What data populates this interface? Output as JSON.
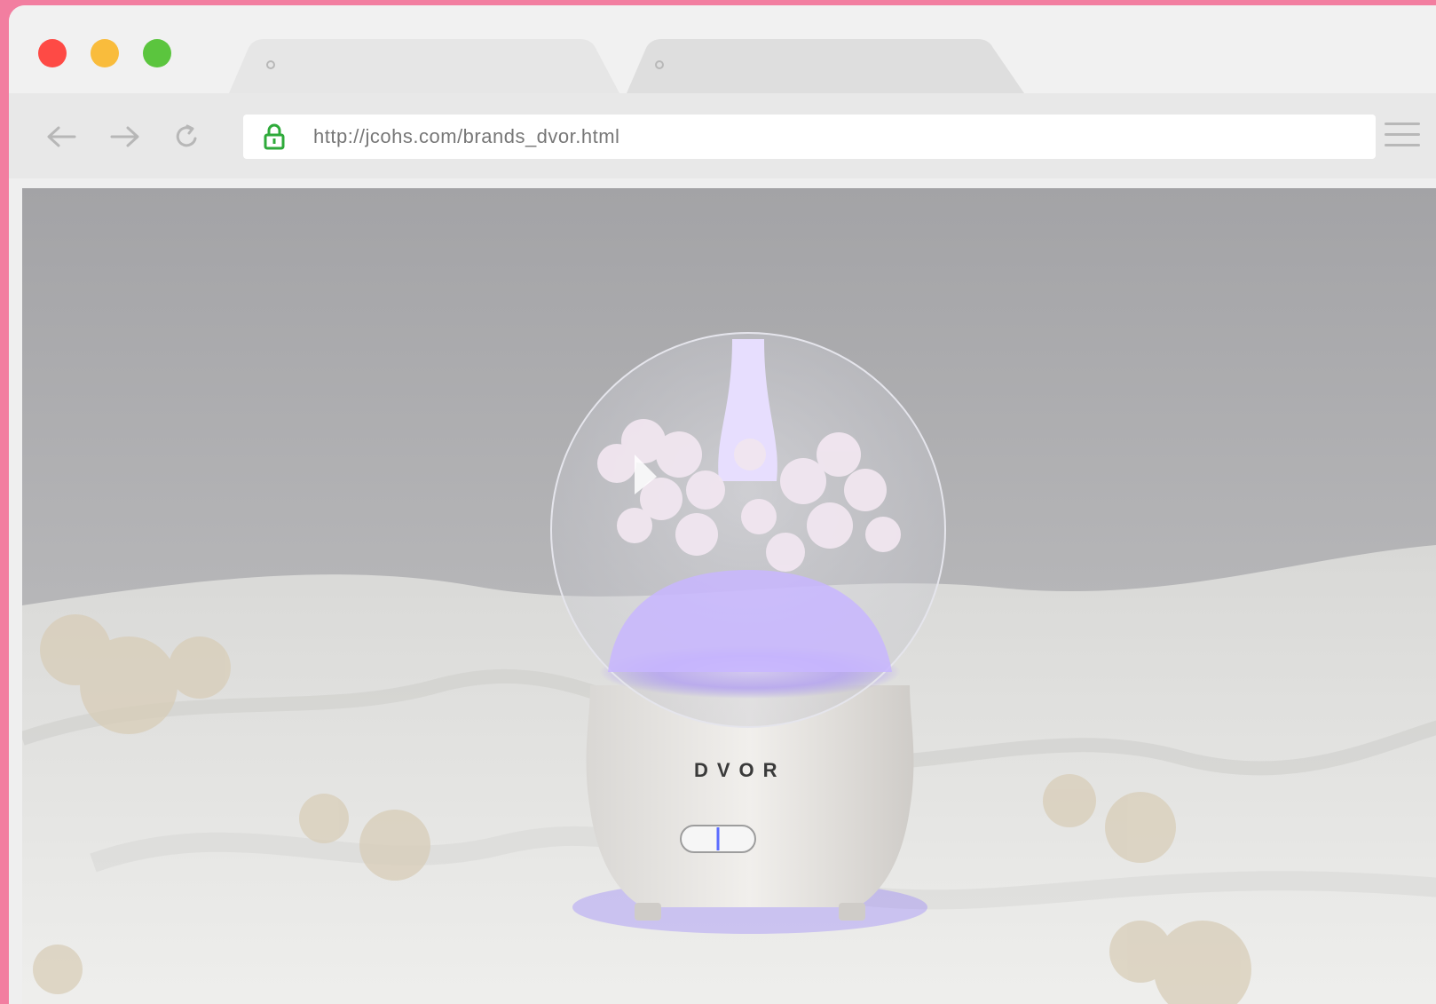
{
  "browser": {
    "tabs": [
      {
        "title": ""
      },
      {
        "title": ""
      }
    ],
    "address": {
      "url": "http://jcohs.com/brands_dvor.html",
      "secure": true,
      "lock_color": "#2eaa3a"
    },
    "nav": {
      "back_icon": "arrow-left-icon",
      "forward_icon": "arrow-right-icon",
      "reload_icon": "reload-icon",
      "menu_icon": "hamburger-menu-icon"
    },
    "traffic_lights": {
      "close_color": "#fe4a45",
      "minimize_color": "#f9bc3c",
      "maximize_color": "#5bc53e"
    }
  },
  "page": {
    "product_brand": "DVOR",
    "frame_color": "#f27ea0"
  }
}
